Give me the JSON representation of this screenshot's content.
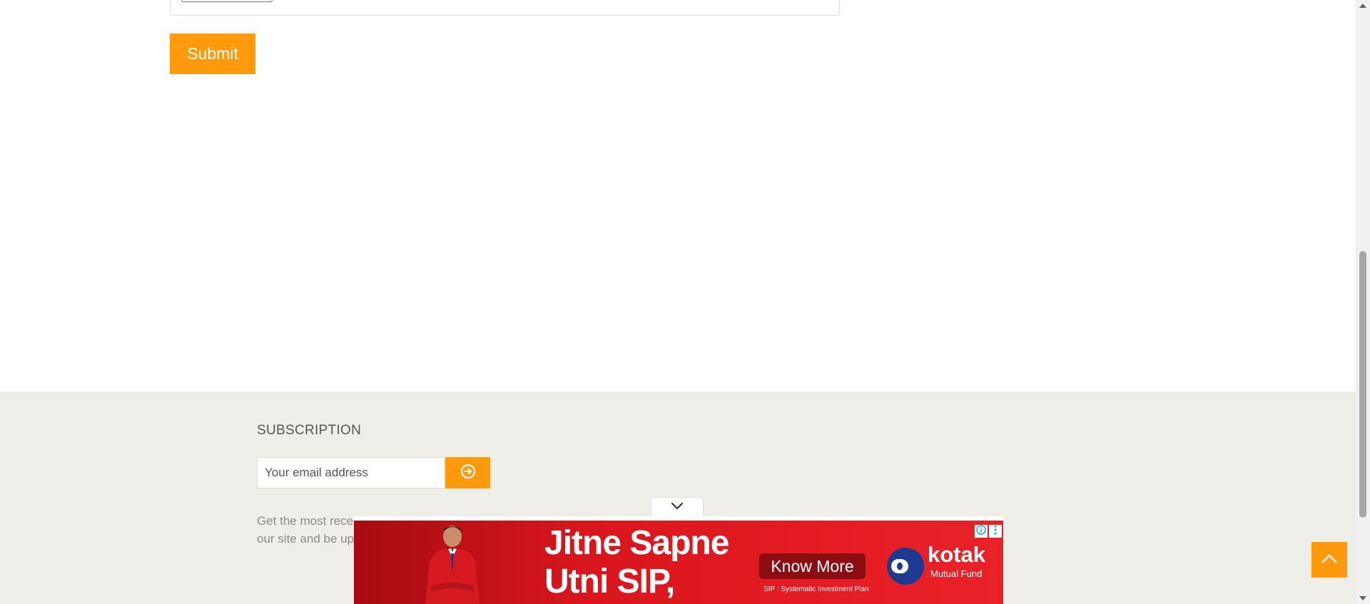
{
  "form": {
    "submit_label": "Submit"
  },
  "footer": {
    "subscription_title": "SUBSCRIPTION",
    "email_placeholder": "Your email address",
    "email_submit_icon": "arrow-circle-right-icon",
    "description": "Get the most recent updates from our site and be up"
  },
  "ad": {
    "headline_line1": "Jitne Sapne",
    "headline_line2": "Utni SIP,",
    "cta_label": "Know More",
    "footnote": "SIP : Systematic Investment Plan",
    "brand_name": "kotak",
    "brand_sub": "Mutual Fund",
    "collapse_icon": "chevron-down-icon",
    "info_icon": "info-icon",
    "menu_icon": "kebab-menu-icon"
  },
  "back_to_top_icon": "chevron-up-icon",
  "colors": {
    "accent": "#ff9a0d",
    "footer_bg": "#efeee8",
    "ad_red": "#e41b22",
    "ad_dark_red": "#8b0d12",
    "brand_blue": "#1c3a8f"
  }
}
